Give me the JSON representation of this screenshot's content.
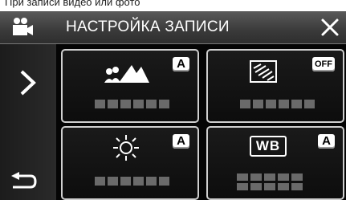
{
  "caption": "При записи видео или фото",
  "header": {
    "title": "НАСТРОЙКА ЗАПИСИ",
    "icons": {
      "mode": "video-camera-icon",
      "close": "close-icon"
    }
  },
  "side": {
    "icons": {
      "next": "chevron-right-icon",
      "back": "return-arrow-icon"
    }
  },
  "tiles": [
    {
      "name": "scene-select",
      "icon": "scene-mountain-people-icon",
      "badge": "A"
    },
    {
      "name": "backlight-compensation",
      "icon": "backlight-icon",
      "badge": "OFF"
    },
    {
      "name": "brightness",
      "icon": "sun-brightness-icon",
      "badge": "A"
    },
    {
      "name": "white-balance",
      "icon": "wb-icon",
      "icon_text": "WB",
      "badge": "A"
    }
  ],
  "colors": {
    "header": "#4a4a4a",
    "background": "#050505",
    "tile_border": "#cfcfcf",
    "badge": "#ffffff"
  }
}
